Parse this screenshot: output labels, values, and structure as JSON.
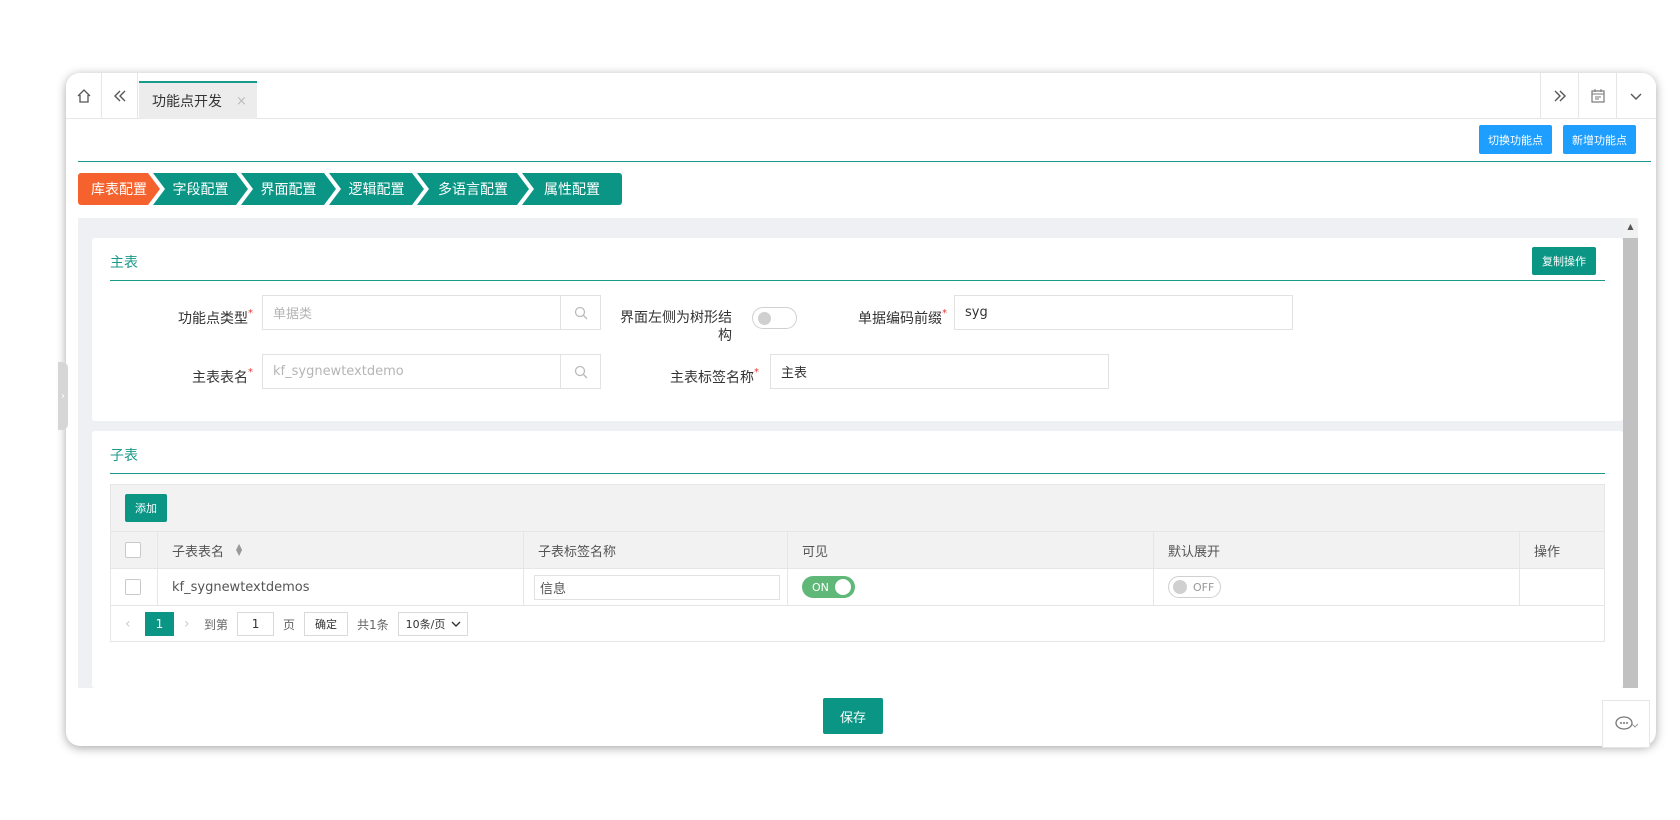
{
  "tabs": {
    "home_icon": "home-icon",
    "active_tab": "功能点开发",
    "close_glyph": "×"
  },
  "actions": {
    "switch_label": "切换功能点",
    "add_label": "新增功能点"
  },
  "steps": [
    "库表配置",
    "字段配置",
    "界面配置",
    "逻辑配置",
    "多语言配置",
    "属性配置"
  ],
  "main_table": {
    "title": "主表",
    "copy_label": "复制操作",
    "func_type_label": "功能点类型",
    "func_type_placeholder": "单据类",
    "tree_label_line1": "界面左侧为树形结",
    "tree_label_line2": "构",
    "prefix_label": "单据编码前缀",
    "prefix_value": "syg",
    "table_name_label": "主表表名",
    "table_name_placeholder": "kf_sygnewtextdemo",
    "tag_name_label": "主表标签名称",
    "tag_name_value": "主表",
    "required_mark": "*"
  },
  "sub_table": {
    "title": "子表",
    "add_label": "添加",
    "columns": [
      "子表表名",
      "子表标签名称",
      "可见",
      "默认展开",
      "操作"
    ],
    "rows": [
      {
        "name": "kf_sygnewtextdemos",
        "tag": "信息",
        "visible": "ON",
        "expand": "OFF"
      }
    ],
    "pager": {
      "current": "1",
      "goto_label": "到第",
      "page_value": "1",
      "page_unit": "页",
      "confirm": "确定",
      "total": "共1条",
      "per_page": "10条/页"
    }
  },
  "save_label": "保存",
  "colors": {
    "teal": "#0a9584",
    "orange": "#f5622d",
    "blue": "#1e9fff",
    "green": "#5fb878"
  }
}
